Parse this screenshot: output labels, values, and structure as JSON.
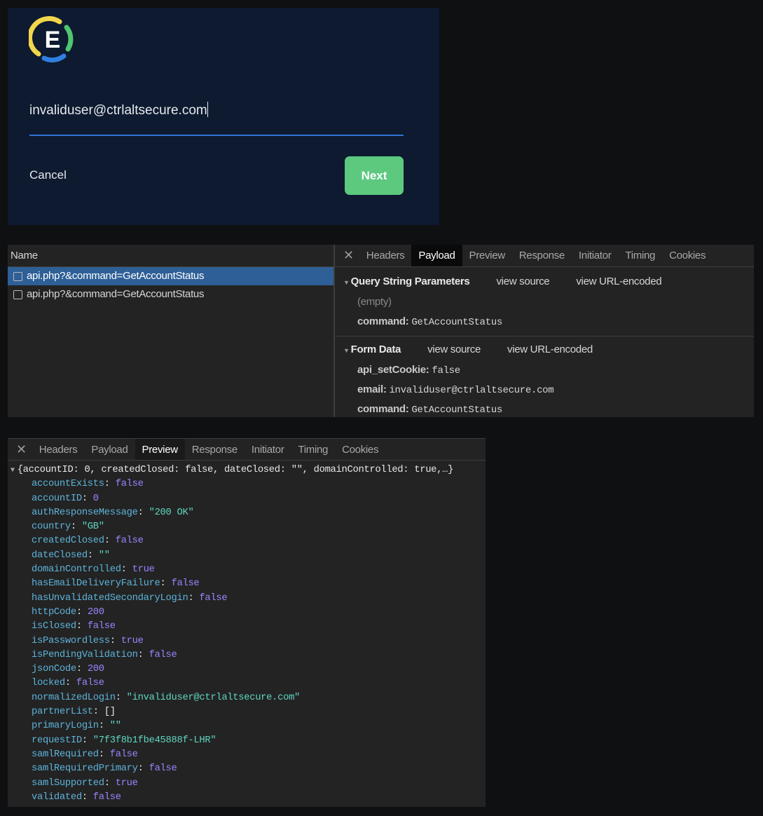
{
  "login": {
    "logo_letter": "E",
    "email_value": "invaliduser@ctrlaltsecure.com",
    "cancel_label": "Cancel",
    "next_label": "Next",
    "colors": {
      "background": "#0d1a2f",
      "accent": "#2f74d6",
      "next_button": "#5cc97f"
    }
  },
  "network": {
    "name_header": "Name",
    "requests": [
      {
        "label": "api.php?&command=GetAccountStatus",
        "selected": true
      },
      {
        "label": "api.php?&command=GetAccountStatus",
        "selected": false
      }
    ],
    "tabs": [
      "Headers",
      "Payload",
      "Preview",
      "Response",
      "Initiator",
      "Timing",
      "Cookies"
    ],
    "active_tab": "Payload",
    "query_section": {
      "title": "Query String Parameters",
      "view_source": "view source",
      "view_encoded": "view URL-encoded",
      "empty_label": "(empty)",
      "params": [
        {
          "key": "command:",
          "value": "GetAccountStatus"
        }
      ]
    },
    "form_section": {
      "title": "Form Data",
      "view_source": "view source",
      "view_encoded": "view URL-encoded",
      "params": [
        {
          "key": "api_setCookie:",
          "value": "false"
        },
        {
          "key": "email:",
          "value": "invaliduser@ctrlaltsecure.com"
        },
        {
          "key": "command:",
          "value": "GetAccountStatus"
        }
      ]
    }
  },
  "preview": {
    "tabs": [
      "Headers",
      "Payload",
      "Preview",
      "Response",
      "Initiator",
      "Timing",
      "Cookies"
    ],
    "active_tab": "Preview",
    "summary": "{accountID: 0, createdClosed: false, dateClosed: \"\", domainControlled: true,…}",
    "fields": [
      {
        "key": "accountExists",
        "value": "false",
        "type": "bool"
      },
      {
        "key": "accountID",
        "value": "0",
        "type": "num"
      },
      {
        "key": "authResponseMessage",
        "value": "\"200 OK\"",
        "type": "str"
      },
      {
        "key": "country",
        "value": "\"GB\"",
        "type": "str"
      },
      {
        "key": "createdClosed",
        "value": "false",
        "type": "bool"
      },
      {
        "key": "dateClosed",
        "value": "\"\"",
        "type": "str"
      },
      {
        "key": "domainControlled",
        "value": "true",
        "type": "bool"
      },
      {
        "key": "hasEmailDeliveryFailure",
        "value": "false",
        "type": "bool"
      },
      {
        "key": "hasUnvalidatedSecondaryLogin",
        "value": "false",
        "type": "bool"
      },
      {
        "key": "httpCode",
        "value": "200",
        "type": "num"
      },
      {
        "key": "isClosed",
        "value": "false",
        "type": "bool"
      },
      {
        "key": "isPasswordless",
        "value": "true",
        "type": "bool"
      },
      {
        "key": "isPendingValidation",
        "value": "false",
        "type": "bool"
      },
      {
        "key": "jsonCode",
        "value": "200",
        "type": "num"
      },
      {
        "key": "locked",
        "value": "false",
        "type": "bool"
      },
      {
        "key": "normalizedLogin",
        "value": "\"invaliduser@ctrlaltsecure.com\"",
        "type": "str"
      },
      {
        "key": "partnerList",
        "value": "[]",
        "type": "other"
      },
      {
        "key": "primaryLogin",
        "value": "\"\"",
        "type": "str"
      },
      {
        "key": "requestID",
        "value": "\"7f3f8b1fbe45888f-LHR\"",
        "type": "str"
      },
      {
        "key": "samlRequired",
        "value": "false",
        "type": "bool"
      },
      {
        "key": "samlRequiredPrimary",
        "value": "false",
        "type": "bool"
      },
      {
        "key": "samlSupported",
        "value": "true",
        "type": "bool"
      },
      {
        "key": "validated",
        "value": "false",
        "type": "bool"
      }
    ],
    "colors": {
      "key": "#5db3da",
      "bool_num": "#9b84ff",
      "string": "#5fd6c0"
    }
  }
}
